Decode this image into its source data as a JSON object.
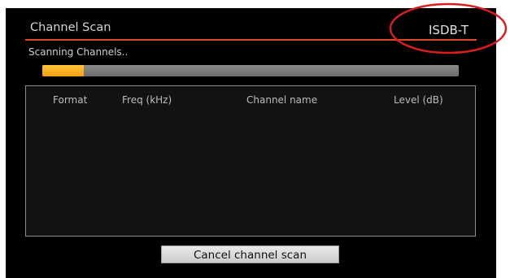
{
  "dialog": {
    "title": "Channel Scan",
    "standard": "ISDB-T",
    "status": "Scanning Channels..",
    "progress_percent": 10
  },
  "table": {
    "columns": [
      "Format",
      "Freq (kHz)",
      "Channel name",
      "Level (dB)"
    ],
    "rows": []
  },
  "actions": {
    "cancel_label": "Cancel channel scan"
  },
  "colors": {
    "accent_line": "#e1452a",
    "progress_fill": "#f5a623",
    "annotation_circle": "#d81e1e"
  }
}
